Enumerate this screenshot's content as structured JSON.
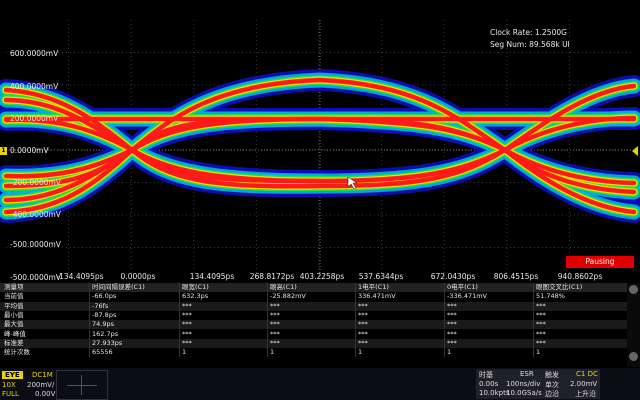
{
  "colors": {
    "ch1": "#e8d400",
    "pausing_bg": "#e00000",
    "eye_core": "#ff1a1a"
  },
  "info": {
    "clock_rate": "Clock Rate: 1.2500G",
    "seg_num": "Seg Num: 89.568k UI"
  },
  "ch_marker": "1",
  "y_labels": [
    "600.0000mV",
    "400.0000mV",
    "200.0000mV",
    "0.0000mV",
    "-200.0000mV",
    "-400.0000mV",
    "-500.0000mV",
    "-500.0000mV"
  ],
  "x_labels": [
    "-134.4095ps",
    "0.0000ps",
    "134.4095ps",
    "268.8172ps",
    "403.2258ps",
    "537.6344ps",
    "672.0430ps",
    "806.4515ps",
    "940.8602ps"
  ],
  "status": "Pausing",
  "measurements": {
    "header": [
      "测量项",
      "时间间隔误差(C1)",
      "眼宽(C1)",
      "眼高(C1)",
      "1电平(C1)",
      "0电平(C1)",
      "眼图交叉比(C1)"
    ],
    "rows": [
      [
        "当前值",
        "-66.0ps",
        "632.3ps",
        "-25.882mV",
        "336.471mV",
        "-336.471mV",
        "51.748%"
      ],
      [
        "平均值",
        "-76fs",
        "***",
        "***",
        "***",
        "***",
        "***"
      ],
      [
        "最小值",
        "-87.8ps",
        "***",
        "***",
        "***",
        "***",
        "***"
      ],
      [
        "最大值",
        "74.9ps",
        "***",
        "***",
        "***",
        "***",
        "***"
      ],
      [
        "峰-峰值",
        "162.7ps",
        "***",
        "***",
        "***",
        "***",
        "***"
      ],
      [
        "标准差",
        "27.933ps",
        "***",
        "***",
        "***",
        "***",
        "***"
      ],
      [
        "统计次数",
        "65556",
        "1",
        "1",
        "1",
        "1",
        "1"
      ]
    ]
  },
  "bottom": {
    "eye_tag": "EYE",
    "dc_tag": "DC1M",
    "probe": "10X",
    "volts_div": "200mV/",
    "bw": "FULL",
    "offset": "0.00V",
    "timebase": {
      "title": "时基",
      "mode": "ESR",
      "delay": "0.00s",
      "tdiv": "100ns/div",
      "mem": "10.0kpts",
      "srate": "10.0GSa/s"
    },
    "trigger": {
      "title": "触发",
      "source": "C1 DC",
      "mode": "单次",
      "level": "2.00mV",
      "type": "边沿",
      "slope": "上升沿"
    }
  }
}
